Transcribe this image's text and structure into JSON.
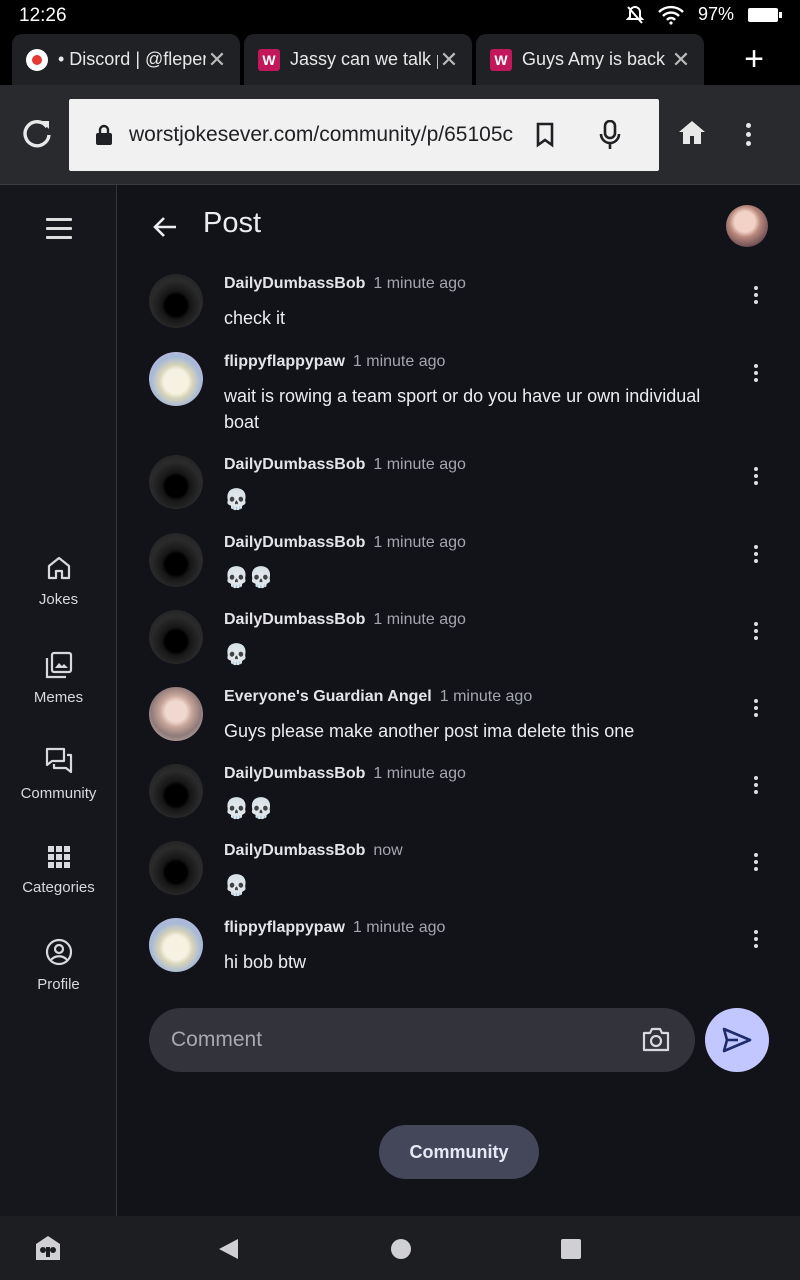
{
  "status_bar": {
    "time": "12:26",
    "battery": "97%"
  },
  "tabs": [
    {
      "title": "• Discord | @fleperone",
      "favicon": "discord-icon",
      "favicon_color": "#e53935"
    },
    {
      "title": "Jassy can we talk plz",
      "favicon": "W",
      "favicon_color": "#c2185b"
    },
    {
      "title": "Guys Amy is back yay",
      "favicon": "W",
      "favicon_color": "#c2185b"
    }
  ],
  "omnibox": {
    "url": "worstjokesever.com/community/p/65105c"
  },
  "sidebar": {
    "items": [
      {
        "label": "Jokes",
        "icon": "home-icon"
      },
      {
        "label": "Memes",
        "icon": "gallery-icon"
      },
      {
        "label": "Community",
        "icon": "forum-icon"
      },
      {
        "label": "Categories",
        "icon": "grid-icon"
      },
      {
        "label": "Profile",
        "icon": "account-circle-icon"
      }
    ]
  },
  "header": {
    "title": "Post"
  },
  "comments": [
    {
      "author": "DailyDumbassBob",
      "time": "1 minute ago",
      "text": "check it",
      "avatar": "hooded-figure"
    },
    {
      "author": "flippyflappypaw",
      "time": "1 minute ago",
      "text": "wait is rowing a team sport or do you have ur own individual boat",
      "avatar": "cat-paw"
    },
    {
      "author": "DailyDumbassBob",
      "time": "1 minute ago",
      "text": "💀",
      "avatar": "hooded-figure"
    },
    {
      "author": "DailyDumbassBob",
      "time": "1 minute ago",
      "text": "💀💀",
      "avatar": "hooded-figure"
    },
    {
      "author": "DailyDumbassBob",
      "time": "1 minute ago",
      "text": "💀",
      "avatar": "hooded-figure"
    },
    {
      "author": "Everyone's Guardian Angel",
      "time": "1 minute ago",
      "text": "Guys please make another post ima delete this one",
      "avatar": "angel-portrait"
    },
    {
      "author": "DailyDumbassBob",
      "time": "1 minute ago",
      "text": "💀💀",
      "avatar": "hooded-figure"
    },
    {
      "author": "DailyDumbassBob",
      "time": "now",
      "text": "💀",
      "avatar": "hooded-figure"
    },
    {
      "author": "flippyflappypaw",
      "time": "1 minute ago",
      "text": "hi bob btw",
      "avatar": "cat-paw"
    }
  ],
  "composer": {
    "placeholder": "Comment"
  },
  "footer_chip": {
    "label": "Community"
  },
  "colors": {
    "accent": "#c2c8ff",
    "background": "#121318",
    "chip": "#434759"
  }
}
